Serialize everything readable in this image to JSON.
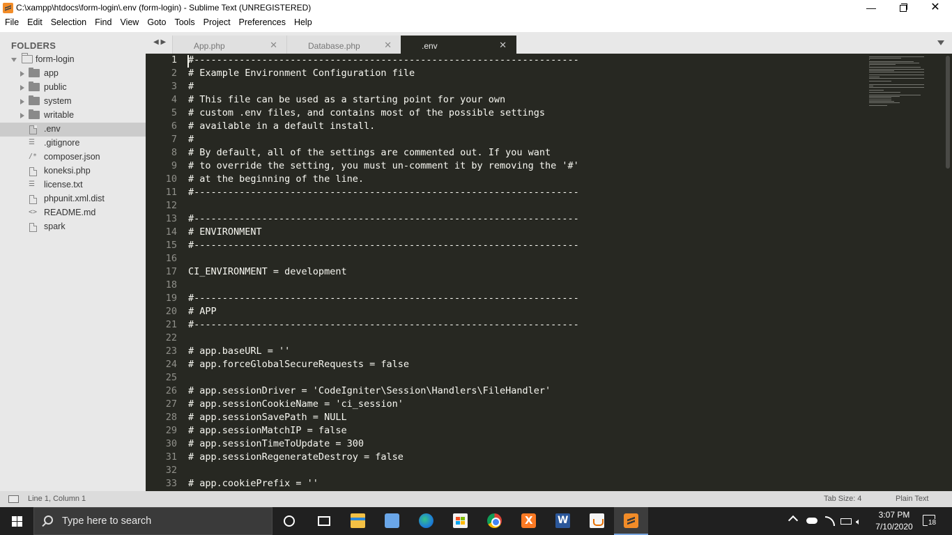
{
  "window": {
    "title": "C:\\xampp\\htdocs\\form-login\\.env (form-login) - Sublime Text (UNREGISTERED)",
    "minimize": "—",
    "close": "✕"
  },
  "menu": [
    "File",
    "Edit",
    "Selection",
    "Find",
    "View",
    "Goto",
    "Tools",
    "Project",
    "Preferences",
    "Help"
  ],
  "sidebar": {
    "header": "FOLDERS",
    "root": "form-login",
    "folders": [
      "app",
      "public",
      "system",
      "writable"
    ],
    "files": [
      ".env",
      ".gitignore",
      "composer.json",
      "koneksi.php",
      "license.txt",
      "phpunit.xml.dist",
      "README.md",
      "spark"
    ],
    "selected": ".env"
  },
  "tabs": {
    "nav": "◀ ▶",
    "items": [
      {
        "label": "App.php",
        "close": "✕"
      },
      {
        "label": "Database.php",
        "close": "✕"
      },
      {
        "label": ".env",
        "close": "✕"
      }
    ],
    "active": ".env"
  },
  "editor": {
    "current_line": 1,
    "lines": [
      "#--------------------------------------------------------------------",
      "# Example Environment Configuration file",
      "#",
      "# This file can be used as a starting point for your own",
      "# custom .env files, and contains most of the possible settings",
      "# available in a default install.",
      "#",
      "# By default, all of the settings are commented out. If you want",
      "# to override the setting, you must un-comment it by removing the '#'",
      "# at the beginning of the line.",
      "#--------------------------------------------------------------------",
      "",
      "#--------------------------------------------------------------------",
      "# ENVIRONMENT",
      "#--------------------------------------------------------------------",
      "",
      "CI_ENVIRONMENT = development",
      "",
      "#--------------------------------------------------------------------",
      "# APP",
      "#--------------------------------------------------------------------",
      "",
      "# app.baseURL = ''",
      "# app.forceGlobalSecureRequests = false",
      "",
      "# app.sessionDriver = 'CodeIgniter\\Session\\Handlers\\FileHandler'",
      "# app.sessionCookieName = 'ci_session'",
      "# app.sessionSavePath = NULL",
      "# app.sessionMatchIP = false",
      "# app.sessionTimeToUpdate = 300",
      "# app.sessionRegenerateDestroy = false",
      "",
      "# app.cookiePrefix = ''"
    ]
  },
  "status": {
    "position": "Line 1, Column 1",
    "tab_size": "Tab Size: 4",
    "syntax": "Plain Text"
  },
  "taskbar": {
    "search_placeholder": "Type here to search",
    "apps": [
      "cortana",
      "task-view",
      "file-explorer",
      "3d-viewer",
      "edge",
      "store",
      "chrome",
      "xampp",
      "word",
      "java",
      "sublime-text"
    ],
    "active_app": "sublime-text",
    "time": "3:07 PM",
    "date": "7/10/2020",
    "notification_count": "18"
  }
}
